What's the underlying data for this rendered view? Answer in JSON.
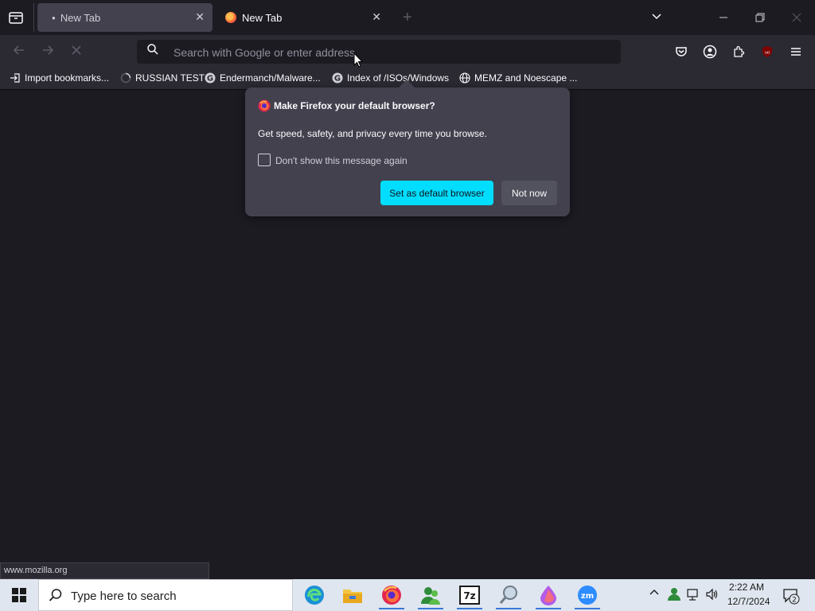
{
  "tabs": [
    {
      "label": "New Tab",
      "active": true
    },
    {
      "label": "New Tab",
      "active": false
    }
  ],
  "urlbar": {
    "placeholder": "Search with Google or enter address"
  },
  "bookmarks": [
    {
      "label": "Import bookmarks...",
      "icon": "import-icon"
    },
    {
      "label": "RUSSIAN TEST",
      "icon": "loading-icon"
    },
    {
      "label": "Endermanch/Malware...",
      "icon": "google-icon"
    },
    {
      "label": "Index of /ISOs/Windows",
      "icon": "google-icon"
    },
    {
      "label": "MEMZ and Noescape ...",
      "icon": "globe-icon"
    }
  ],
  "popup": {
    "title": "Make Firefox your default browser?",
    "body": "Get speed, safety, and privacy every time you browse.",
    "checkbox_label": "Don't show this message again",
    "primary_button": "Set as default browser",
    "secondary_button": "Not now"
  },
  "status_text": "www.mozilla.org",
  "taskbar": {
    "search_placeholder": "Type here to search",
    "apps": [
      "edge-icon",
      "file-explorer-icon",
      "firefox-icon",
      "contacts-icon",
      "7zip-icon",
      "search-tool-icon",
      "fluid-icon",
      "zoom-icon"
    ],
    "seven_zip_label": "7z",
    "zoom_label": "zm",
    "clock_time": "2:22 AM",
    "clock_date": "12/7/2024",
    "notification_count": "2"
  },
  "colors": {
    "accent": "#00ddff",
    "background": "#1c1b22",
    "toolbar": "#2b2a33",
    "popup": "#42414d"
  }
}
